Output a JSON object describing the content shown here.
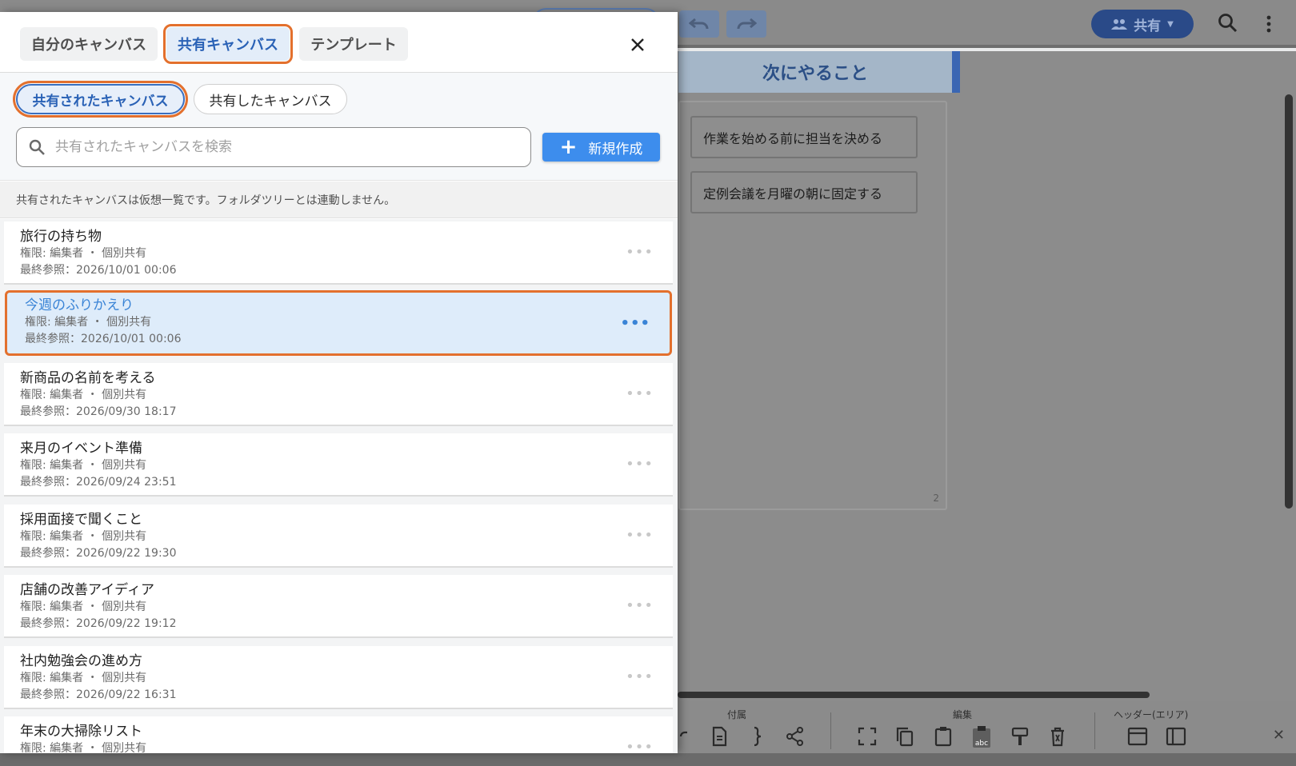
{
  "app": {
    "share_label": "共有",
    "area_title": "次にやること",
    "area_count": "2",
    "stickies": [
      "作業を始める前に担当を決める",
      "定例会議を月曜の朝に固定する"
    ],
    "bottom_groups": [
      "付属",
      "編集",
      "ヘッダー(エリア)"
    ]
  },
  "drawer": {
    "tabs": [
      {
        "label": "自分のキャンバス",
        "active": false
      },
      {
        "label": "共有キャンバス",
        "active": true
      },
      {
        "label": "テンプレート",
        "active": false
      }
    ],
    "chips": [
      {
        "label": "共有されたキャンバス",
        "active": true
      },
      {
        "label": "共有したキャンバス",
        "active": false
      }
    ],
    "search": {
      "placeholder": "共有されたキャンバスを検索",
      "value": ""
    },
    "new_button_label": "新規作成",
    "notice": "共有されたキャンバスは仮想一覧です。フォルダツリーとは連動しません。",
    "items": [
      {
        "title": "旅行の持ち物",
        "permission": "権限: 編集者 ・ 個別共有",
        "last_viewed": "最終参照：2026/10/01 00:06",
        "selected": false
      },
      {
        "title": "今週のふりかえり",
        "permission": "権限: 編集者 ・ 個別共有",
        "last_viewed": "最終参照：2026/10/01 00:06",
        "selected": true
      },
      {
        "title": "新商品の名前を考える",
        "permission": "権限: 編集者 ・ 個別共有",
        "last_viewed": "最終参照：2026/09/30 18:17",
        "selected": false
      },
      {
        "title": "来月のイベント準備",
        "permission": "権限: 編集者 ・ 個別共有",
        "last_viewed": "最終参照：2026/09/24 23:51",
        "selected": false
      },
      {
        "title": "採用面接で聞くこと",
        "permission": "権限: 編集者 ・ 個別共有",
        "last_viewed": "最終参照：2026/09/22 19:30",
        "selected": false
      },
      {
        "title": "店舗の改善アイディア",
        "permission": "権限: 編集者 ・ 個別共有",
        "last_viewed": "最終参照：2026/09/22 19:12",
        "selected": false
      },
      {
        "title": "社内勉強会の進め方",
        "permission": "権限: 編集者 ・ 個別共有",
        "last_viewed": "最終参照：2026/09/22 16:31",
        "selected": false
      },
      {
        "title": "年末の大掃除リスト",
        "permission": "権限: 編集者 ・ 個別共有",
        "last_viewed": "",
        "selected": false
      }
    ]
  },
  "colors": {
    "accent": "#3d8ded",
    "highlight": "#e3702d",
    "selected_bg": "#deecfa"
  }
}
